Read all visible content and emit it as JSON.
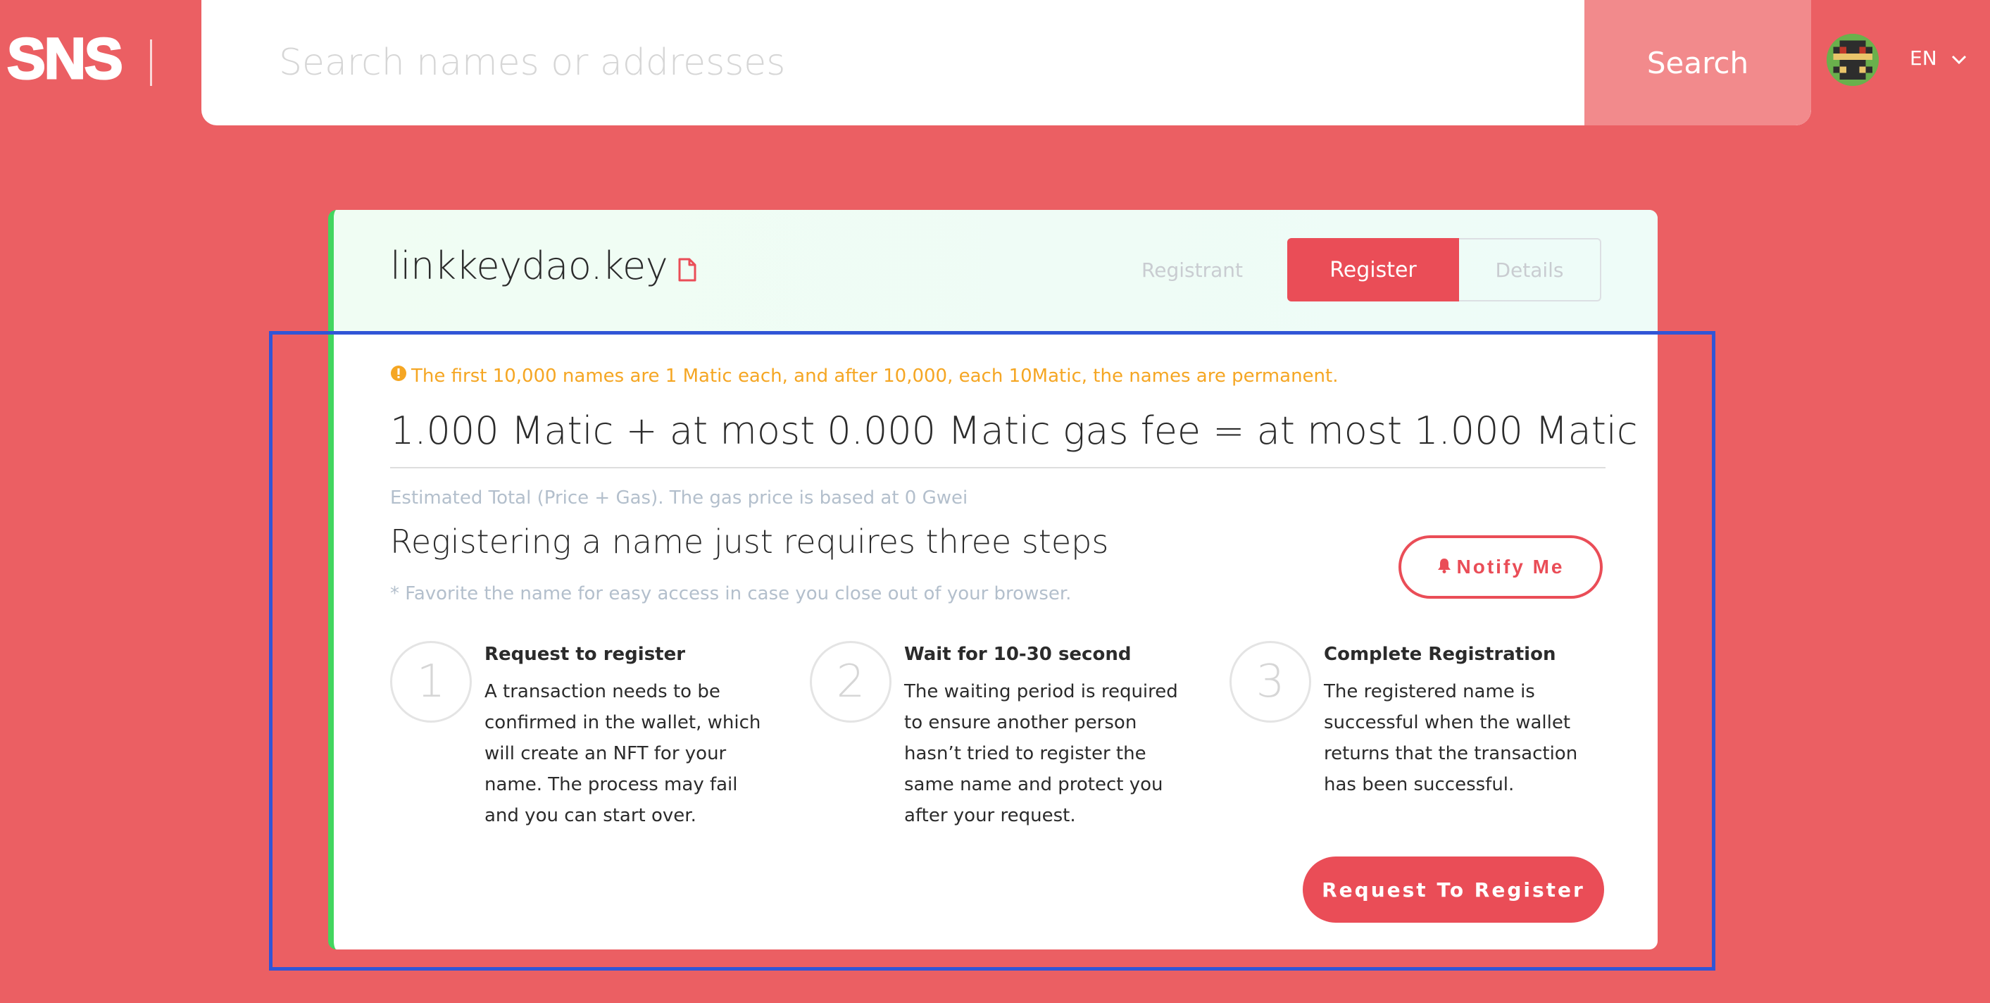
{
  "header": {
    "logo_text": "SNS",
    "search_placeholder": "Search names or addresses",
    "search_button_label": "Search",
    "language": "EN",
    "avatar_icon": "pixel-avatar-icon"
  },
  "card": {
    "domain_name": "linkkeydao.key",
    "tabs": {
      "registrant": "Registrant",
      "register": "Register",
      "details": "Details"
    },
    "notice": "The first 10,000 names are 1 Matic each, and after 10,000, each 10Matic, the names are permanent.",
    "price_line": "1.000 Matic + at most 0.000 Matic gas fee = at most 1.000 Matic",
    "estimate_note": "Estimated Total (Price + Gas). The gas price is based at 0 Gwei",
    "steps_heading": "Registering a name just requires three steps",
    "favorite_note": "* Favorite the name for easy access in case you close out of your browser.",
    "notify_label": "Notify Me",
    "steps": [
      {
        "number": "1",
        "title": "Request to register",
        "body": "A transaction needs to be confirmed in the wallet, which will create an NFT for your name. The process may fail and you can start over."
      },
      {
        "number": "2",
        "title": "Wait for 10-30 second",
        "body": "The waiting period is required to ensure another person hasn’t tried to register the same name and protect you after your request."
      },
      {
        "number": "3",
        "title": "Complete Registration",
        "body": "The registered name is successful when the wallet returns that the transaction has been successful."
      }
    ],
    "request_button_label": "Request To Register"
  },
  "colors": {
    "background": "#eb5f63",
    "accent": "#ea4d57",
    "notice": "#f5a623",
    "highlight_box": "#3155d6",
    "card_left_border": "#42d65f"
  }
}
